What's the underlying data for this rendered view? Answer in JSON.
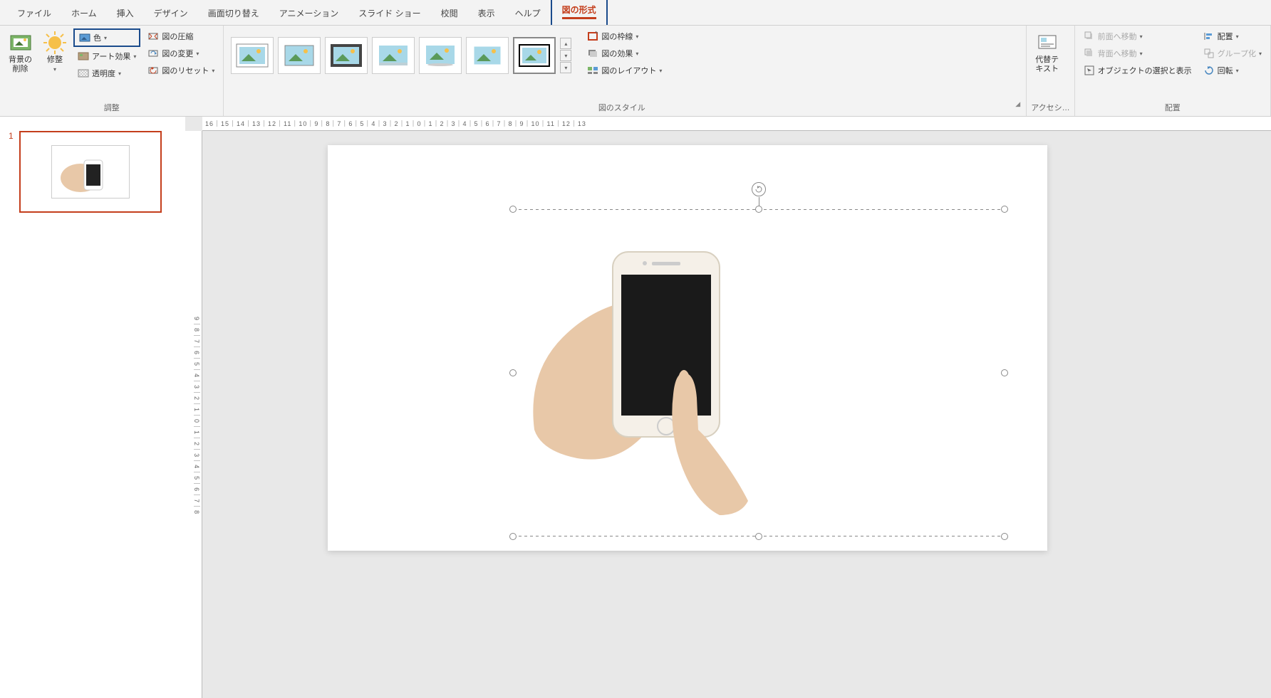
{
  "tabs": {
    "file": "ファイル",
    "home": "ホーム",
    "insert": "挿入",
    "design": "デザイン",
    "transitions": "画面切り替え",
    "animations": "アニメーション",
    "slideshow": "スライド ショー",
    "review": "校閲",
    "view": "表示",
    "help": "ヘルプ",
    "picformat": "図の形式"
  },
  "ribbon": {
    "adjust": {
      "label": "調整",
      "removebg": "背景の\n削除",
      "corrections": "修整",
      "color": "色",
      "artistic": "アート効果",
      "transparency": "透明度",
      "compress": "図の圧縮",
      "change": "図の変更",
      "reset": "図のリセット"
    },
    "styles": {
      "label": "図のスタイル",
      "border": "図の枠線",
      "effects": "図の効果",
      "layout": "図のレイアウト"
    },
    "access": {
      "label": "アクセシ…",
      "alttext": "代替テ\nキスト"
    },
    "arrange": {
      "label": "配置",
      "front": "前面へ移動",
      "back": "背面へ移動",
      "selpane": "オブジェクトの選択と表示",
      "align": "配置",
      "group": "グループ化",
      "rotate": "回転"
    }
  },
  "ruler": {
    "h": "16｜15｜14｜13｜12｜11｜10｜9｜8｜7｜6｜5｜4｜3｜2｜1｜0｜1｜2｜3｜4｜5｜6｜7｜8｜9｜10｜11｜12｜13",
    "v": "9｜8｜7｜6｜5｜4｜3｜2｜1｜0｜1｜2｜3｜4｜5｜6｜7｜8"
  },
  "thumb": {
    "num": "1"
  }
}
